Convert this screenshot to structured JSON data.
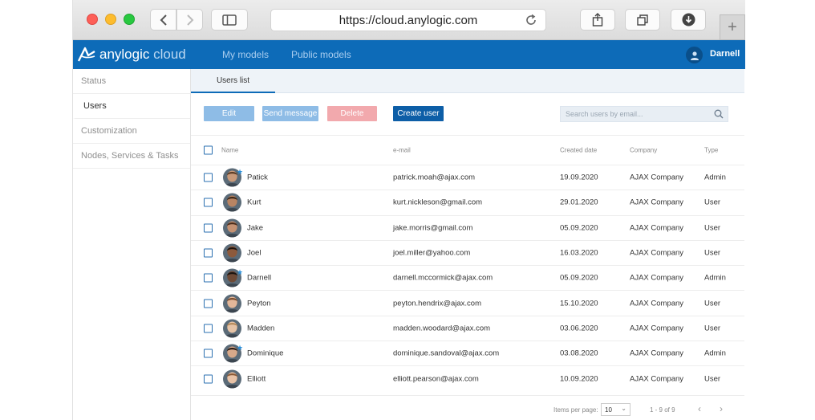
{
  "browser": {
    "url": "https://cloud.anylogic.com"
  },
  "app": {
    "logo_brand": "anylogic",
    "logo_product": "cloud",
    "nav": [
      "My models",
      "Public models"
    ],
    "user": "Darnell"
  },
  "sidebar": {
    "items": [
      {
        "label": "Status"
      },
      {
        "label": "Users"
      },
      {
        "label": "Customization"
      },
      {
        "label": "Nodes, Services & Tasks"
      }
    ],
    "active": "Users"
  },
  "tab": "Users list",
  "toolbar": {
    "edit": "Edit",
    "send": "Send message",
    "delete": "Delete",
    "create": "Create user",
    "search_placeholder": "Search users by email..."
  },
  "table": {
    "headers": {
      "name": "Name",
      "email": "e-mail",
      "date": "Created date",
      "company": "Company",
      "type": "Type"
    },
    "rows": [
      {
        "name": "Patick",
        "email": "patrick.moah@ajax.com",
        "date": "19.09.2020",
        "company": "AJAX Company",
        "type": "Admin",
        "starred": true,
        "skin": "#c99a7a",
        "hair": "#5a3b24"
      },
      {
        "name": "Kurt",
        "email": "kurt.nickleson@gmail.com",
        "date": "29.01.2020",
        "company": "AJAX Company",
        "type": "User",
        "starred": false,
        "skin": "#b88463",
        "hair": "#3b2616"
      },
      {
        "name": "Jake",
        "email": "jake.morris@gmail.com",
        "date": "05.09.2020",
        "company": "AJAX Company",
        "type": "User",
        "starred": false,
        "skin": "#c59273",
        "hair": "#4b2d1c"
      },
      {
        "name": "Joel",
        "email": "joel.miller@yahoo.com",
        "date": "16.03.2020",
        "company": "AJAX Company",
        "type": "User",
        "starred": false,
        "skin": "#8d5a3c",
        "hair": "#1e130c"
      },
      {
        "name": "Darnell",
        "email": "darnell.mccormick@ajax.com",
        "date": "05.09.2020",
        "company": "AJAX Company",
        "type": "Admin",
        "starred": true,
        "skin": "#6e4a36",
        "hair": "#1a1410"
      },
      {
        "name": "Peyton",
        "email": "peyton.hendrix@ajax.com",
        "date": "15.10.2020",
        "company": "AJAX Company",
        "type": "User",
        "starred": false,
        "skin": "#e2b79a",
        "hair": "#7a4b2c"
      },
      {
        "name": "Madden",
        "email": "madden.woodard@ajax.com",
        "date": "03.06.2020",
        "company": "AJAX Company",
        "type": "User",
        "starred": false,
        "skin": "#e6c3a6",
        "hair": "#b58a5a"
      },
      {
        "name": "Dominique",
        "email": "dominique.sandoval@ajax.com",
        "date": "03.08.2020",
        "company": "AJAX Company",
        "type": "Admin",
        "starred": true,
        "skin": "#d8a98a",
        "hair": "#2b1a12"
      },
      {
        "name": "Elliott",
        "email": "elliott.pearson@ajax.com",
        "date": "10.09.2020",
        "company": "AJAX Company",
        "type": "User",
        "starred": false,
        "skin": "#e8c2a6",
        "hair": "#8a5a36"
      }
    ]
  },
  "footer": {
    "items_per_page_label": "Items per page:",
    "items_per_page": "10",
    "range": "1 - 9 of 9"
  }
}
